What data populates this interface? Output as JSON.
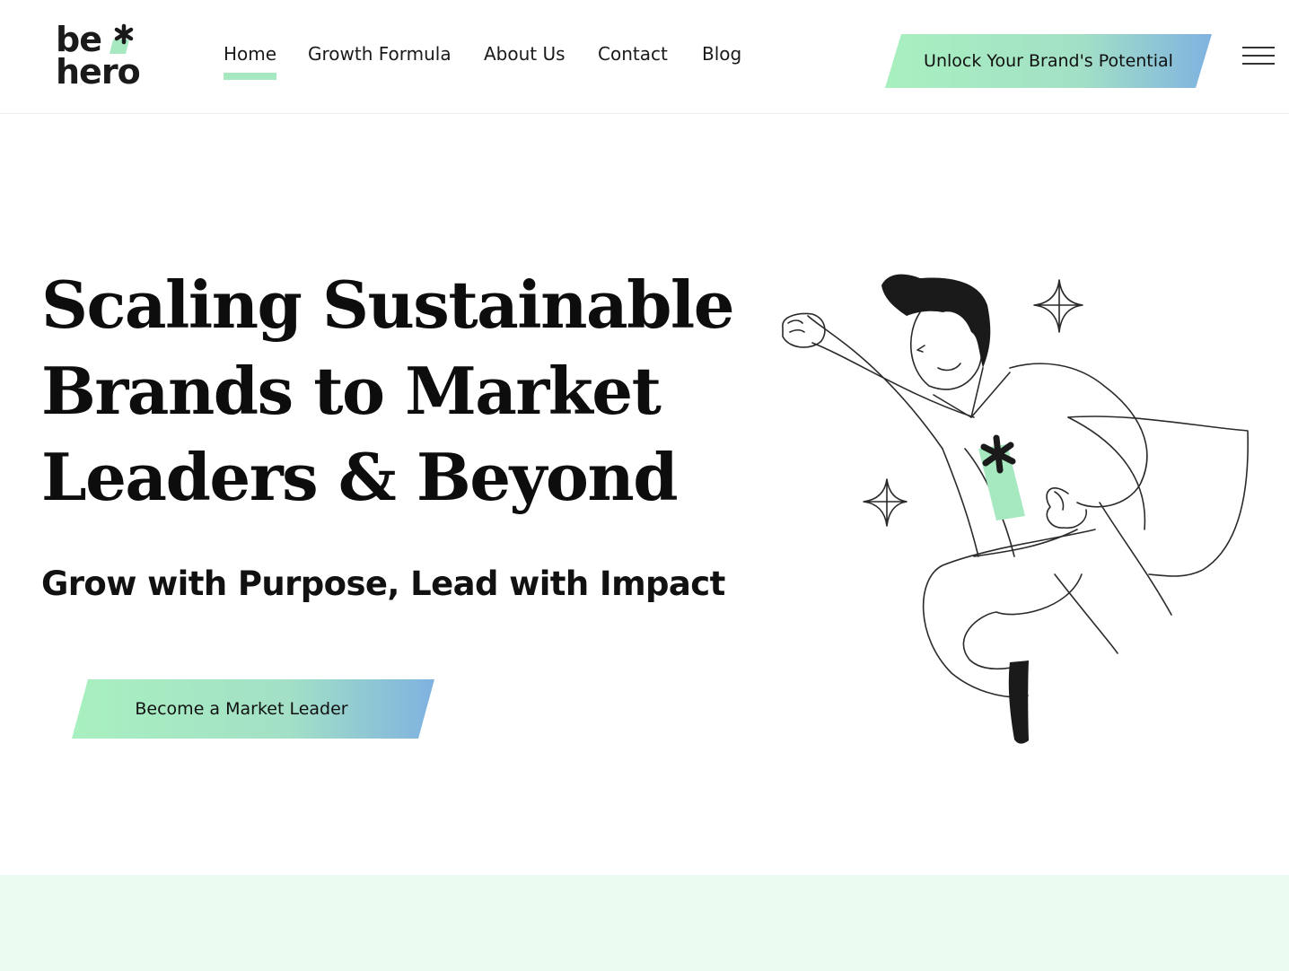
{
  "brand": {
    "logo_line1": "be",
    "logo_line2": "hero",
    "accent_color": "#a6e8bf",
    "gradient_start": "#a8f0c0",
    "gradient_end": "#7fb2e0"
  },
  "nav": {
    "items": [
      {
        "label": "Home",
        "active": true
      },
      {
        "label": "Growth Formula",
        "active": false
      },
      {
        "label": "About Us",
        "active": false
      },
      {
        "label": "Contact",
        "active": false
      },
      {
        "label": "Blog",
        "active": false
      }
    ],
    "cta_label": "Unlock Your Brand's Potential",
    "menu_icon": "hamburger-icon"
  },
  "hero": {
    "title_lines": [
      "Scaling Sustainable",
      "Brands to Market",
      "Leaders & Beyond"
    ],
    "subtitle": "Grow with Purpose, Lead with Impact",
    "cta_label": "Become a Market Leader",
    "illustration_icon": "superhero-illustration"
  }
}
